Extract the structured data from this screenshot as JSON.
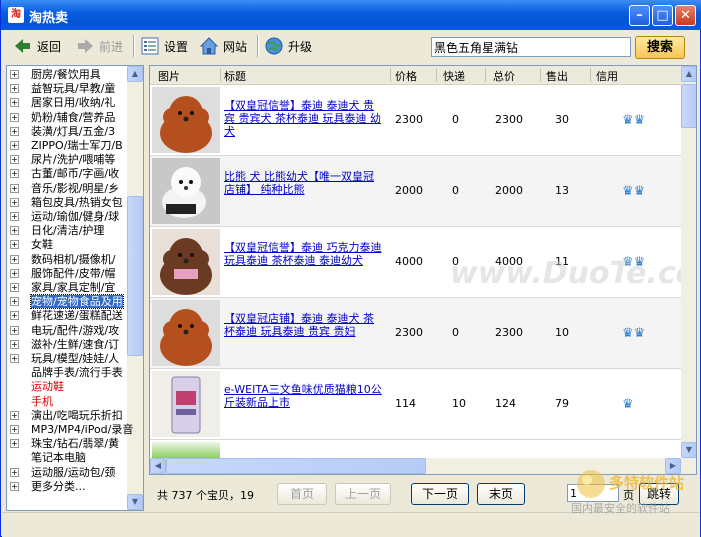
{
  "window": {
    "title": "淘热卖",
    "app_icon": "淘"
  },
  "toolbar": {
    "back": "返回",
    "forward": "前进",
    "settings": "设置",
    "website": "网站",
    "upgrade": "升级"
  },
  "search": {
    "value": "黑色五角星满钻",
    "button": "搜索"
  },
  "sidebar": {
    "items": [
      {
        "label": "厨房/餐饮用具",
        "state": "normal"
      },
      {
        "label": "益智玩具/早教/童",
        "state": "normal"
      },
      {
        "label": "居家日用/收纳/礼",
        "state": "normal"
      },
      {
        "label": "奶粉/辅食/营养品",
        "state": "normal"
      },
      {
        "label": "装潢/灯具/五金/3",
        "state": "normal"
      },
      {
        "label": "ZIPPO/瑞士军刀/B",
        "state": "normal"
      },
      {
        "label": "尿片/洗护/喂哺等",
        "state": "normal"
      },
      {
        "label": "古董/邮币/字画/收",
        "state": "normal"
      },
      {
        "label": "音乐/影视/明星/乡",
        "state": "normal"
      },
      {
        "label": "箱包皮具/热销女包",
        "state": "normal"
      },
      {
        "label": "运动/瑜伽/健身/球",
        "state": "normal"
      },
      {
        "label": "日化/清洁/护理",
        "state": "normal"
      },
      {
        "label": "女鞋",
        "state": "normal"
      },
      {
        "label": "数码相机/摄像机/",
        "state": "normal"
      },
      {
        "label": "服饰配件/皮带/帽",
        "state": "normal"
      },
      {
        "label": "家具/家具定制/宜",
        "state": "normal"
      },
      {
        "label": "宠物/宠物食品及用",
        "state": "selected"
      },
      {
        "label": "鲜花速递/蛋糕配送",
        "state": "normal"
      },
      {
        "label": "电玩/配件/游戏/攻",
        "state": "normal"
      },
      {
        "label": "滋补/生鲜/速食/订",
        "state": "normal"
      },
      {
        "label": "玩具/模型/娃娃/人",
        "state": "normal"
      },
      {
        "label": "品牌手表/流行手表",
        "state": "leaf"
      },
      {
        "label": "运动鞋",
        "state": "leaf-red"
      },
      {
        "label": "手机",
        "state": "leaf-red"
      },
      {
        "label": "演出/吃喝玩乐折扣",
        "state": "normal"
      },
      {
        "label": "MP3/MP4/iPod/录音",
        "state": "normal"
      },
      {
        "label": "珠宝/钻石/翡翠/黄",
        "state": "normal"
      },
      {
        "label": "笔记本电脑",
        "state": "leaf"
      },
      {
        "label": "运动服/运动包/颈",
        "state": "normal"
      },
      {
        "label": "更多分类...",
        "state": "normal"
      }
    ]
  },
  "table": {
    "headers": [
      "图片",
      "标题",
      "价格",
      "快递",
      "总价",
      "售出",
      "信用"
    ],
    "rows": [
      {
        "title": "【双皇冠信誉】泰迪 泰迪犬 贵宾 贵宾犬 茶杯泰迪 玩具泰迪 幼犬",
        "price": "2300",
        "express": "0",
        "total": "2300",
        "sold": "30",
        "credit": "♛♛",
        "photo": "brown-poodle"
      },
      {
        "title": "比熊 犬 比熊幼犬【唯一双皇冠店铺】 纯种比熊",
        "price": "2000",
        "express": "0",
        "total": "2000",
        "sold": "13",
        "credit": "♛♛",
        "photo": "white-bichon"
      },
      {
        "title": "【双皇冠信誉】泰迪 巧克力泰迪 玩具泰迪 茶杯泰迪 泰迪幼犬",
        "price": "4000",
        "express": "0",
        "total": "4000",
        "sold": "11",
        "credit": "♛♛",
        "photo": "chocolate-poodle"
      },
      {
        "title": "【双皇冠店铺】泰迪 泰迪犬 茶杯泰迪 玩具泰迪 贵宾 贵妇",
        "price": "2300",
        "express": "0",
        "total": "2300",
        "sold": "10",
        "credit": "♛♛",
        "photo": "brown-poodle"
      },
      {
        "title": "e-WEITA三文鱼味优质猫粮10公斤装新品上市",
        "price": "114",
        "express": "10",
        "total": "124",
        "sold": "79",
        "credit": "♛",
        "photo": "cat-food-bag"
      }
    ]
  },
  "watermark": "www.DuoTe.com",
  "pager": {
    "summary": "共 737 个宝贝，19",
    "first": "首页",
    "prev": "上一页",
    "next": "下一页",
    "last": "末页",
    "page_value": "1",
    "page_unit": "页",
    "go": "跳转"
  },
  "logo": {
    "text": "多特软件站",
    "slogan": "国内最安全的软件站"
  }
}
